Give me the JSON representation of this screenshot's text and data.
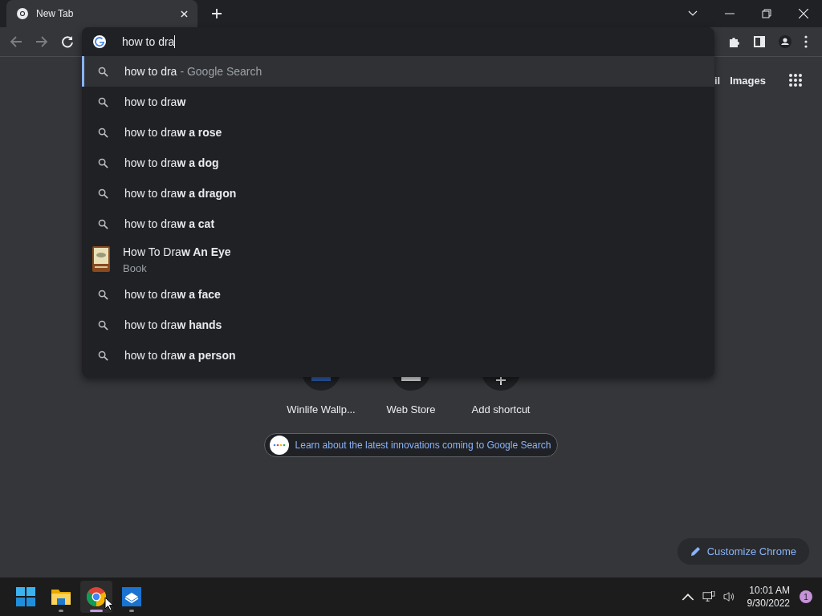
{
  "tabs": [
    {
      "title": "New Tab",
      "selected": true
    }
  ],
  "omnibox": {
    "value": "how to dra"
  },
  "suggestions": [
    {
      "kind": "search",
      "text": "how to dra",
      "hint": "- Google Search",
      "selected": true
    },
    {
      "kind": "search",
      "text": "how to dra**w**",
      "selected": false
    },
    {
      "kind": "search",
      "text": "how to dra**w a rose**",
      "selected": false
    },
    {
      "kind": "search",
      "text": "how to dra**w a dog**",
      "selected": false
    },
    {
      "kind": "search",
      "text": "how to dra**w a dragon**",
      "selected": false
    },
    {
      "kind": "search",
      "text": "how to dra**w a cat**",
      "selected": false
    },
    {
      "kind": "entity",
      "text": "How To Dra**w An Eye**",
      "subtitle": "Book",
      "selected": false
    },
    {
      "kind": "search",
      "text": "how to dra**w a face**",
      "selected": false
    },
    {
      "kind": "search",
      "text": "how to dra**w hands**",
      "selected": false
    },
    {
      "kind": "search",
      "text": "how to dra**w a person**",
      "selected": false
    }
  ],
  "page": {
    "header_links": [
      "il",
      "Images"
    ],
    "shortcuts": [
      {
        "kind": "wallpaper",
        "label": "Winlife Wallp..."
      },
      {
        "kind": "store",
        "label": "Web Store"
      },
      {
        "kind": "add",
        "label": "Add shortcut"
      }
    ],
    "promo": "Learn about the latest innovations coming to Google Search",
    "customize": "Customize Chrome"
  },
  "taskbar": {
    "apps": [
      {
        "kind": "start",
        "running": false,
        "selected": false
      },
      {
        "kind": "explorer",
        "running": true,
        "selected": false
      },
      {
        "kind": "chrome",
        "running": true,
        "selected": true
      },
      {
        "kind": "mail",
        "running": true,
        "selected": false
      }
    ],
    "time": "10:01 AM",
    "date": "9/30/2022",
    "notifications": "1"
  }
}
